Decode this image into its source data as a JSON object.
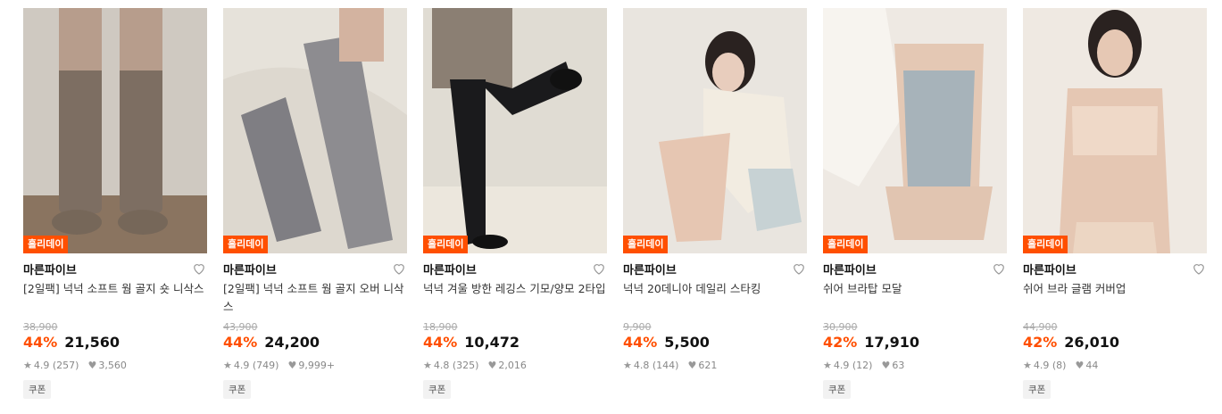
{
  "products": [
    {
      "badge": "홀리데이",
      "brand": "마른파이브",
      "title": "[2일팩] 넉넉 소프트 웜 골지 숏 니삭스",
      "original_price": "38,900",
      "discount": "44%",
      "price": "21,560",
      "rating": "4.9",
      "reviews": "(257)",
      "likes": "3,560",
      "coupon": "쿠폰",
      "heart_icon": "heart-outline-icon"
    },
    {
      "badge": "홀리데이",
      "brand": "마른파이브",
      "title": "[2일팩] 넉넉 소프트 웜 골지 오버 니삭스",
      "original_price": "43,900",
      "discount": "44%",
      "price": "24,200",
      "rating": "4.9",
      "reviews": "(749)",
      "likes": "9,999+",
      "coupon": "쿠폰",
      "heart_icon": "heart-outline-icon"
    },
    {
      "badge": "홀리데이",
      "brand": "마른파이브",
      "title": "넉넉 겨울 방한 레깅스 기모/양모 2타입",
      "original_price": "18,900",
      "discount": "44%",
      "price": "10,472",
      "rating": "4.8",
      "reviews": "(325)",
      "likes": "2,016",
      "coupon": "쿠폰",
      "heart_icon": "heart-outline-icon"
    },
    {
      "badge": "홀리데이",
      "brand": "마른파이브",
      "title": "넉넉 20데니아 데일리 스타킹",
      "original_price": "9,900",
      "discount": "44%",
      "price": "5,500",
      "rating": "4.8",
      "reviews": "(144)",
      "likes": "621",
      "coupon": "",
      "heart_icon": "heart-outline-icon"
    },
    {
      "badge": "홀리데이",
      "brand": "마른파이브",
      "title": "쉬어 브라탑 모달",
      "original_price": "30,900",
      "discount": "42%",
      "price": "17,910",
      "rating": "4.9",
      "reviews": "(12)",
      "likes": "63",
      "coupon": "쿠폰",
      "heart_icon": "heart-outline-icon"
    },
    {
      "badge": "홀리데이",
      "brand": "마른파이브",
      "title": "쉬어 브라 글램 커버업",
      "original_price": "44,900",
      "discount": "42%",
      "price": "26,010",
      "rating": "4.9",
      "reviews": "(8)",
      "likes": "44",
      "coupon": "쿠폰",
      "heart_icon": "heart-outline-icon"
    }
  ],
  "colors": {
    "accent": "#ff4f00"
  }
}
